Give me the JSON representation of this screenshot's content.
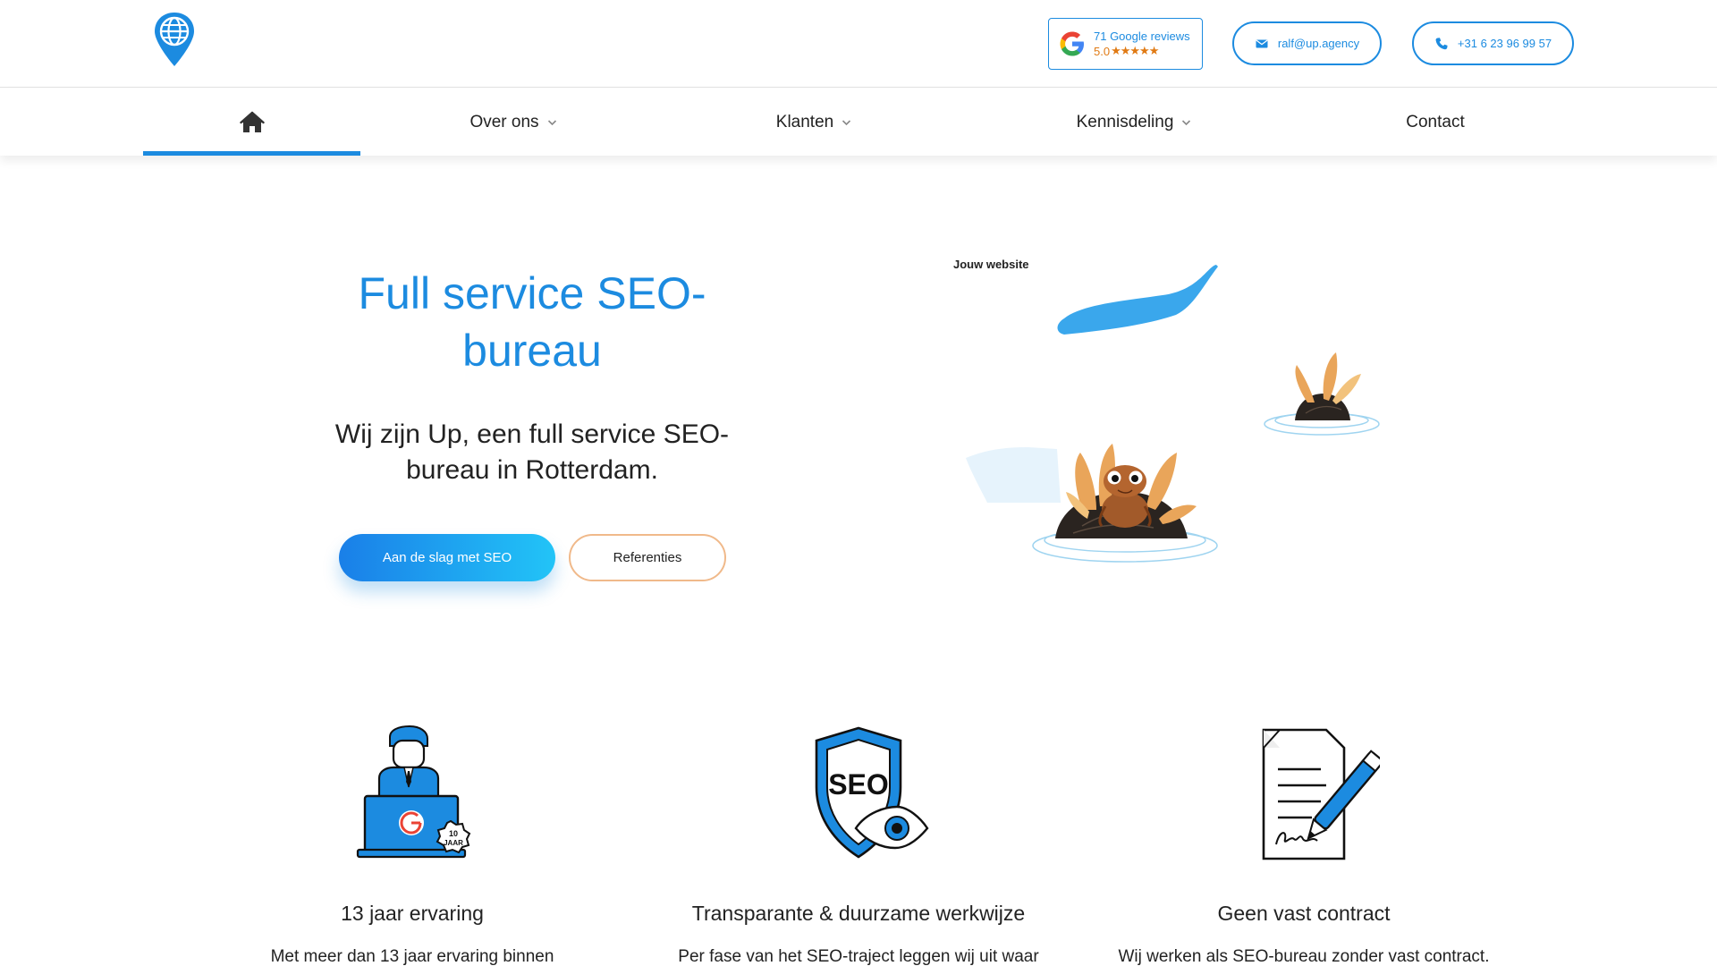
{
  "header": {
    "logo_icon": "globe-pin-icon",
    "reviews": {
      "count_text": "71 Google reviews",
      "score": "5.0",
      "stars": "★★★★★"
    },
    "email": "ralf@up.agency",
    "phone": "+31 6 23 96 99 57"
  },
  "nav": {
    "home_icon": "home-icon",
    "items": [
      {
        "label": "Over ons",
        "dropdown": true
      },
      {
        "label": "Klanten",
        "dropdown": true
      },
      {
        "label": "Kennisdeling",
        "dropdown": true
      },
      {
        "label": "Contact",
        "dropdown": false
      }
    ],
    "active": "home"
  },
  "hero": {
    "title": "Full service SEO-bureau",
    "subtitle": "Wij zijn Up, een full service SEO-bureau in Rotterdam.",
    "primary_button": "Aan de slag met SEO",
    "secondary_button": "Referenties",
    "illustration_label": "Jouw website"
  },
  "features": [
    {
      "icon": "seo-consultant-icon",
      "badge": "10 JAAR",
      "title": "13 jaar ervaring",
      "text": "Met meer dan 13 jaar ervaring binnen"
    },
    {
      "icon": "seo-shield-eye-icon",
      "badge": "SEO",
      "title": "Transparante & duurzame werkwijze",
      "text": "Per fase van het SEO-traject leggen wij uit waar"
    },
    {
      "icon": "signed-contract-icon",
      "badge": "Ralf",
      "title": "Geen vast contract",
      "text": "Wij werken als SEO-bureau zonder vast contract."
    }
  ],
  "colors": {
    "accent": "#1c8be0",
    "star": "#e07a14",
    "secondary_border": "#f0b98a"
  }
}
